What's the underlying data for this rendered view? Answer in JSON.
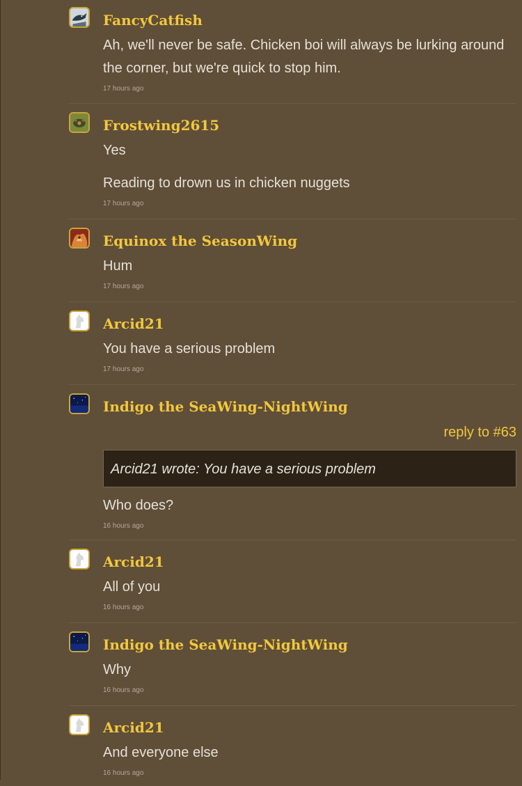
{
  "comments": [
    {
      "author": "FancyCatfish",
      "avatar_icon": "catfish-avatar-icon",
      "paragraphs": [
        "Ah, we'll never be safe. Chicken boi will always be lurking around the corner, but we're quick to stop him."
      ],
      "time": "17 hours ago"
    },
    {
      "author": "Frostwing2615",
      "avatar_icon": "dragon-avatar-icon",
      "paragraphs": [
        "Yes",
        "Reading to drown us in chicken nuggets"
      ],
      "time": "17 hours ago"
    },
    {
      "author": "Equinox the SeasonWing",
      "avatar_icon": "seasonwing-avatar-icon",
      "paragraphs": [
        "Hum"
      ],
      "time": "17 hours ago"
    },
    {
      "author": "Arcid21",
      "avatar_icon": "default-horse-avatar-icon",
      "paragraphs": [
        "You have a serious problem"
      ],
      "time": "17 hours ago"
    },
    {
      "author": "Indigo the SeaWing-NightWing",
      "avatar_icon": "night-sky-avatar-icon",
      "reply_to": "reply to #63",
      "quote": "Arcid21 wrote: You have a serious problem",
      "paragraphs": [
        "Who does?"
      ],
      "time": "16 hours ago"
    },
    {
      "author": "Arcid21",
      "avatar_icon": "default-horse-avatar-icon",
      "paragraphs": [
        "All of you"
      ],
      "time": "16 hours ago"
    },
    {
      "author": "Indigo the SeaWing-NightWing",
      "avatar_icon": "night-sky-avatar-icon",
      "paragraphs": [
        "Why"
      ],
      "time": "16 hours ago"
    },
    {
      "author": "Arcid21",
      "avatar_icon": "default-horse-avatar-icon",
      "paragraphs": [
        "And everyone else"
      ],
      "time": "16 hours ago"
    }
  ],
  "colors": {
    "background": "#5f4e38",
    "author_name": "#f2c83d",
    "body_text": "#e6e1d7",
    "quote_background": "#2d2216"
  }
}
